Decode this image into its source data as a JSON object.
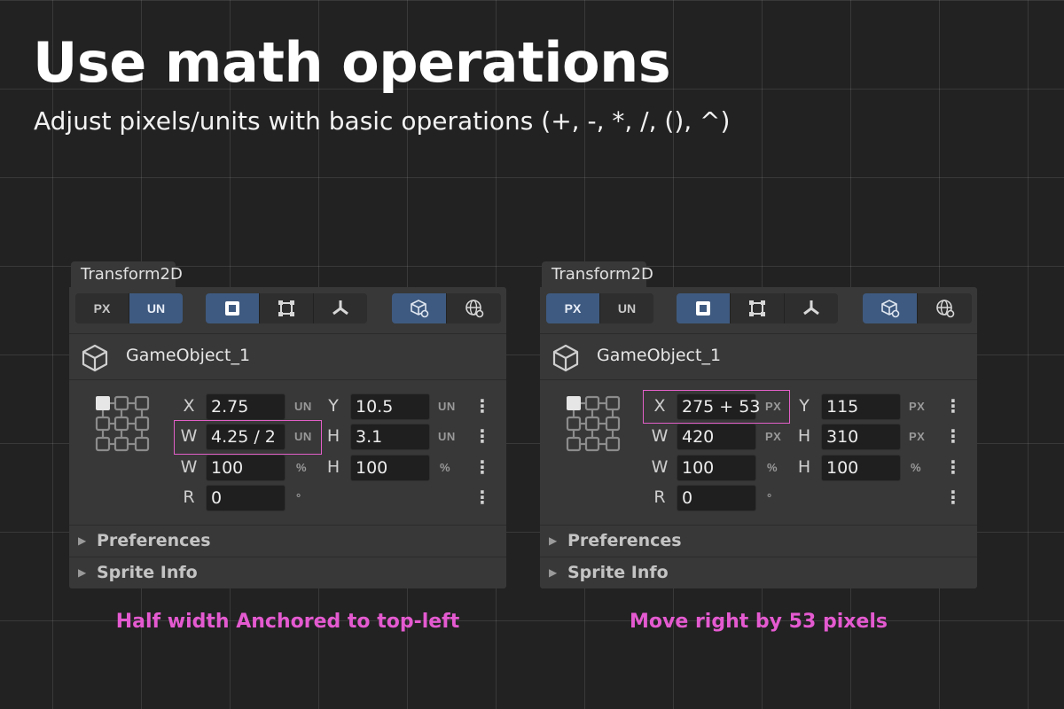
{
  "hero": {
    "title": "Use math operations",
    "subtitle": "Adjust pixels/units with basic operations (+, -, *, /, (), ^)"
  },
  "colors": {
    "accent": "#e45ad0",
    "active": "#3f5a80",
    "panel": "#383838",
    "field": "#1f1f1f"
  },
  "panels": [
    {
      "tab": "Transform2D",
      "unit_toggle": {
        "px": "PX",
        "un": "UN",
        "active": "UN"
      },
      "object_name": "GameObject_1",
      "rows": {
        "x": {
          "label": "X",
          "value": "2.75",
          "unit": "UN"
        },
        "y": {
          "label": "Y",
          "value": "10.5",
          "unit": "UN"
        },
        "w": {
          "label": "W",
          "value": "4.25 / 2",
          "unit": "UN"
        },
        "h": {
          "label": "H",
          "value": "3.1",
          "unit": "UN"
        },
        "sw": {
          "label": "W",
          "value": "100",
          "unit": "%"
        },
        "sh": {
          "label": "H",
          "value": "100",
          "unit": "%"
        },
        "r": {
          "label": "R",
          "value": "0",
          "unit": "°"
        }
      },
      "sections": [
        "Preferences",
        "Sprite Info"
      ],
      "caption": "Half width Anchored to top-left"
    },
    {
      "tab": "Transform2D",
      "unit_toggle": {
        "px": "PX",
        "un": "UN",
        "active": "PX"
      },
      "object_name": "GameObject_1",
      "rows": {
        "x": {
          "label": "X",
          "value": "275 + 53",
          "unit": "PX"
        },
        "y": {
          "label": "Y",
          "value": "115",
          "unit": "PX"
        },
        "w": {
          "label": "W",
          "value": "420",
          "unit": "PX"
        },
        "h": {
          "label": "H",
          "value": "310",
          "unit": "PX"
        },
        "sw": {
          "label": "W",
          "value": "100",
          "unit": "%"
        },
        "sh": {
          "label": "H",
          "value": "100",
          "unit": "%"
        },
        "r": {
          "label": "R",
          "value": "0",
          "unit": "°"
        }
      },
      "sections": [
        "Preferences",
        "Sprite Info"
      ],
      "caption": "Move right by 53 pixels"
    }
  ],
  "icons": {
    "mode": [
      "rect-mode-icon",
      "bounds-mode-icon",
      "pivot-mode-icon"
    ],
    "space": [
      "local-space-icon",
      "world-space-icon"
    ],
    "object": "cube-icon",
    "anchor": "anchor-grid-icon",
    "more": "kebab-menu-icon",
    "collapse": "triangle-right-icon"
  }
}
